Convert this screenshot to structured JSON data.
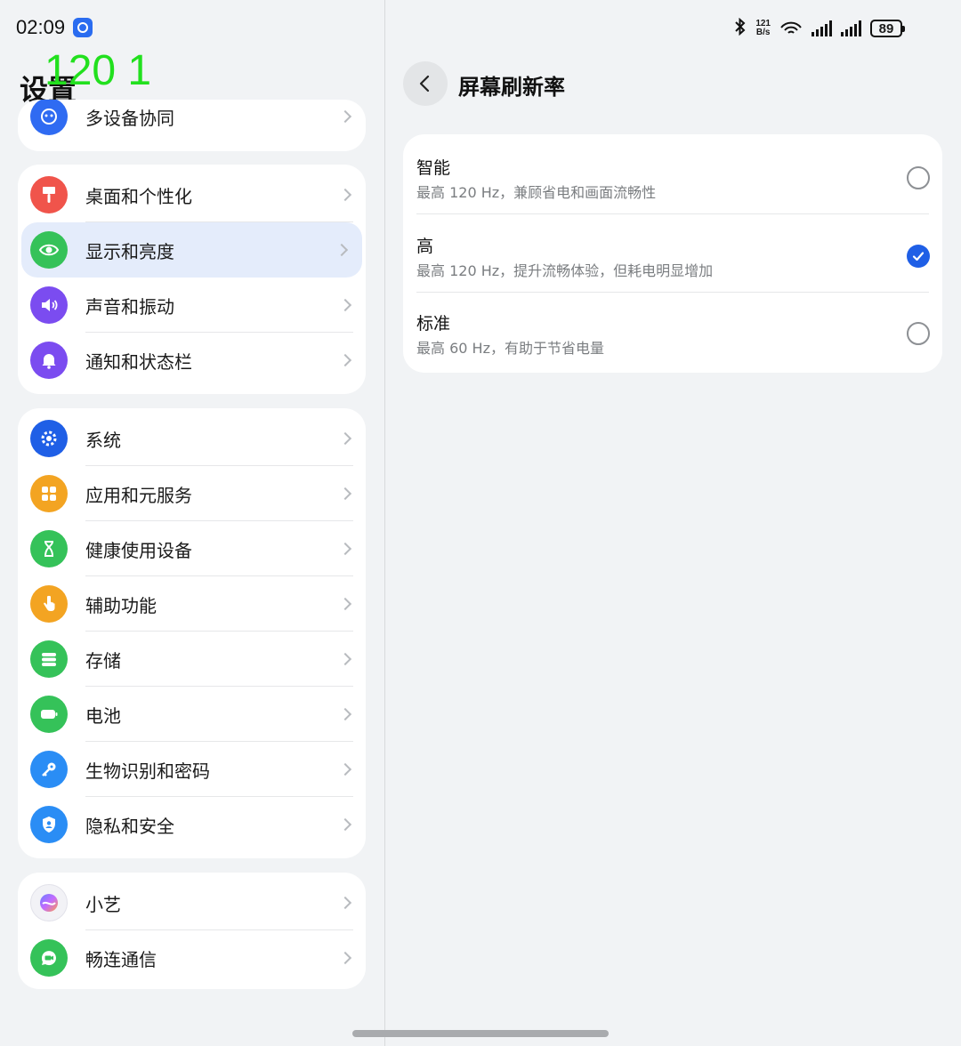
{
  "status_bar": {
    "time": "02:09",
    "speed_value": "121",
    "speed_unit": "B/s",
    "battery": "89"
  },
  "overlay_text": "120 1",
  "left_pane": {
    "title": "设置",
    "partial_item": {
      "label": "多设备协同",
      "icon": "multi-device-icon",
      "color": "#2f6bf2"
    },
    "groups": [
      [
        {
          "label": "桌面和个性化",
          "icon": "paintbrush-icon",
          "color": "#f0544b",
          "active": false
        },
        {
          "label": "显示和亮度",
          "icon": "eye-icon",
          "color": "#35c259",
          "active": true
        },
        {
          "label": "声音和振动",
          "icon": "speaker-icon",
          "color": "#7b4cf0",
          "active": false
        },
        {
          "label": "通知和状态栏",
          "icon": "bell-icon",
          "color": "#7b4cf0",
          "active": false
        }
      ],
      [
        {
          "label": "系统",
          "icon": "gear-icon",
          "color": "#1f5fe6"
        },
        {
          "label": "应用和元服务",
          "icon": "apps-grid-icon",
          "color": "#f3a422"
        },
        {
          "label": "健康使用设备",
          "icon": "hourglass-icon",
          "color": "#35c259"
        },
        {
          "label": "辅助功能",
          "icon": "hand-pointer-icon",
          "color": "#f3a422"
        },
        {
          "label": "存储",
          "icon": "storage-icon",
          "color": "#35c259"
        },
        {
          "label": "电池",
          "icon": "battery-icon",
          "color": "#35c259"
        },
        {
          "label": "生物识别和密码",
          "icon": "key-icon",
          "color": "#2a8df5"
        },
        {
          "label": "隐私和安全",
          "icon": "shield-icon",
          "color": "#2a8df5"
        }
      ],
      [
        {
          "label": "小艺",
          "icon": "assistant-orb-icon",
          "color": "#f2f2f6"
        },
        {
          "label": "畅连通信",
          "icon": "video-call-icon",
          "color": "#35c259"
        }
      ]
    ]
  },
  "right_pane": {
    "title": "屏幕刷新率",
    "options": [
      {
        "title": "智能",
        "subtitle": "最高 120 Hz，兼顾省电和画面流畅性",
        "selected": false
      },
      {
        "title": "高",
        "subtitle": "最高 120 Hz，提升流畅体验，但耗电明显增加",
        "selected": true
      },
      {
        "title": "标准",
        "subtitle": "最高 60 Hz，有助于节省电量",
        "selected": false
      }
    ]
  },
  "accent_color": "#1f5fe6"
}
